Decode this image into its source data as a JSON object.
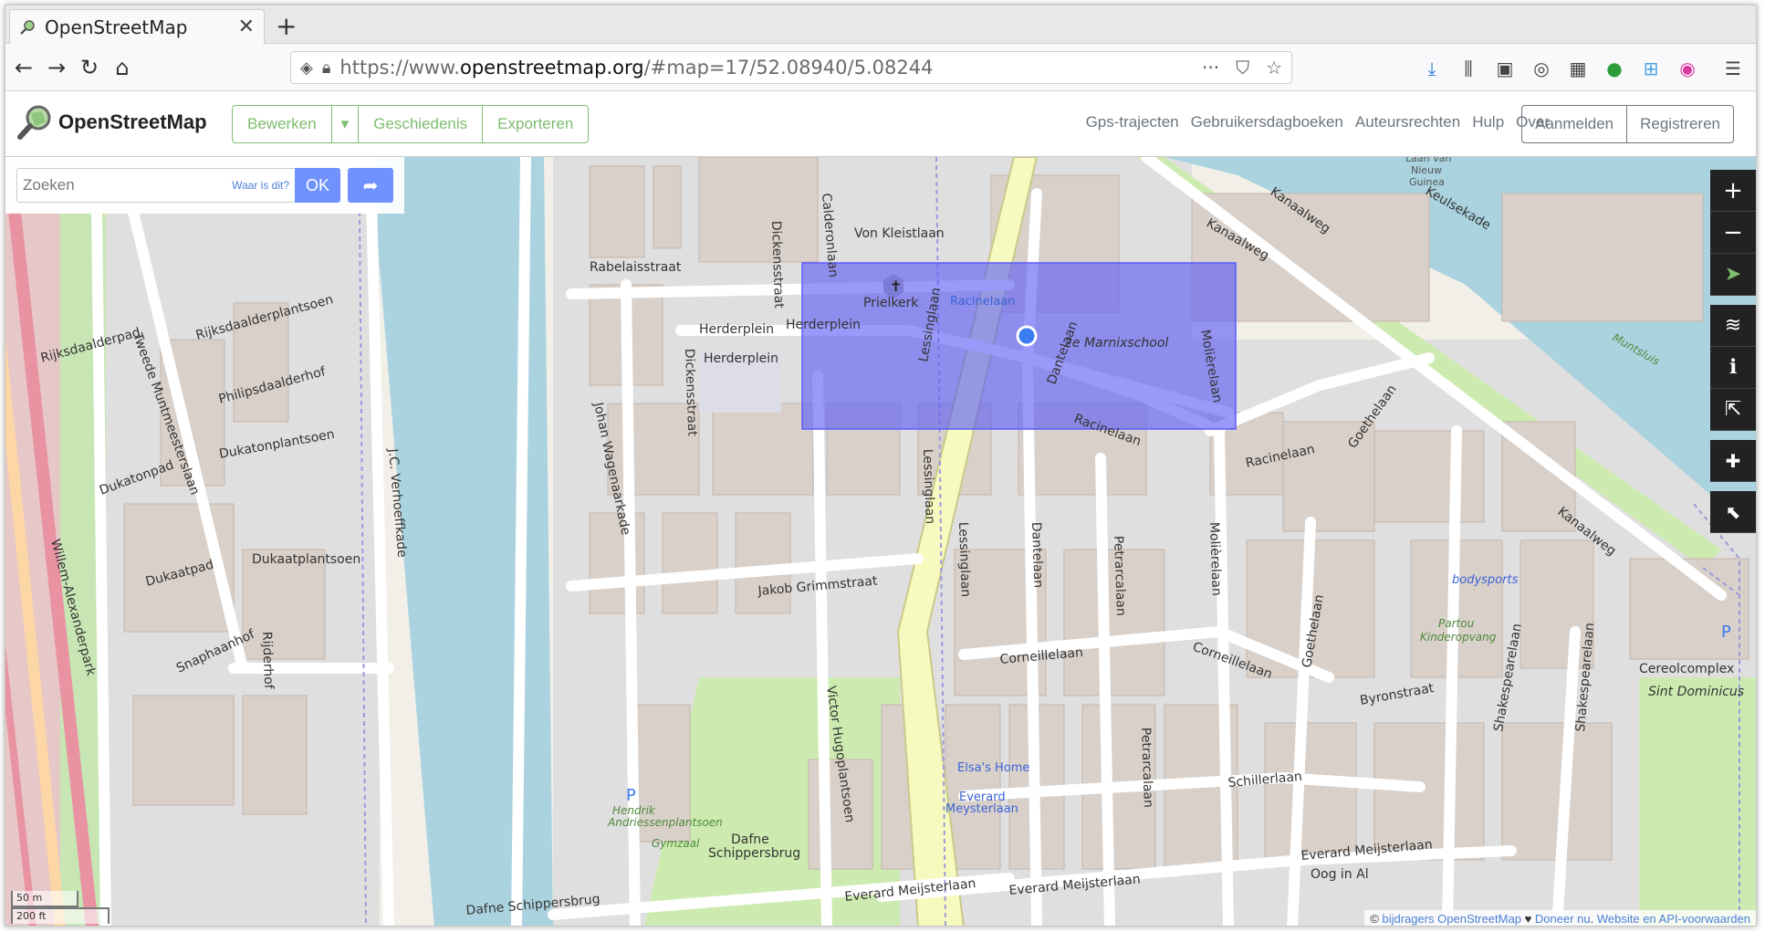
{
  "browser": {
    "tab_title": "OpenStreetMap",
    "url_prefix": "https://www.",
    "url_domain": "openstreetmap.org",
    "url_rest": "/#map=17/52.08940/5.08244"
  },
  "osm": {
    "logo_text": "OpenStreetMap",
    "edit_label": "Bewerken",
    "history_label": "Geschiedenis",
    "export_label": "Exporteren",
    "nav": [
      "Gps-trajecten",
      "Gebruikersdagboeken",
      "Auteursrechten",
      "Hulp",
      "Over"
    ],
    "login_label": "Aanmelden",
    "register_label": "Registreren"
  },
  "search": {
    "placeholder": "Zoeken",
    "where_label": "Waar is dit?",
    "ok_label": "OK"
  },
  "map": {
    "streets": {
      "s1": "Johan Wagenaarkade",
      "s2": "Rabelaisstraat",
      "s3": "Von Kleistlaan",
      "s4": "Herderplein",
      "s5": "Dickensstraat",
      "s6": "Lessinglaan",
      "s7": "Dantelaan",
      "s8": "Racinelaan",
      "s9": "Molièrelaan",
      "s10": "Kanaalweg",
      "s11": "Keulsekade",
      "s12": "Goethelaan",
      "s13": "Jakob Grimmstraat",
      "s14": "Corneillelaan",
      "s15": "Petrarcalaan",
      "s16": "Byronstraat",
      "s17": "Schillerlaan",
      "s18": "Everard Meijsterlaan",
      "s19": "Shakespearelaan",
      "s20": "Victor Hugoplantsoen",
      "s21": "Tweede Muntmeesterslaan",
      "s22": "Rijksdaalderplantsoen",
      "s23": "Philipsdaalderhof",
      "s24": "Dukatonplantsoen",
      "s25": "Dukatonpad",
      "s26": "Dukaatplantsoen",
      "s27": "Dukaatpad",
      "s28": "Snaphaanhof",
      "s29": "Rijderhof",
      "s30": "J.C. Verhoeffkade",
      "s31": "Willem-Alexanderpark",
      "s32": "Dafne Schippersbrug",
      "s33": "Rijksdaalderpad",
      "s34": "Calderonlaan",
      "s35": "Muntsluis"
    },
    "pois": {
      "church": "Prielkerk",
      "school": "2e Marnixschool",
      "bus": "Racinelaan",
      "sports": "bodysports",
      "kinder1": "Partou",
      "kinder2": "Kinderopvang",
      "cinema": "Cereolcomplex",
      "stdom": "Sint Dominicus",
      "elsa": "Elsa's Home",
      "everard1": "Everard",
      "everard2": "Meysterlaan",
      "gym": "Gymzaal",
      "dafne1": "Dafne",
      "dafne2": "Schippersbrug",
      "park1": "Hendrik",
      "park2": "Andriessenplantsoen",
      "oog": "Oog in Al",
      "nieuw1": "Laan van",
      "nieuw2": "Nieuw",
      "nieuw3": "Guinea",
      "herderplein_sq": "Herderplein"
    },
    "scale_m": "50 m",
    "scale_ft": "200 ft",
    "attribution_prefix": "© ",
    "attribution_link": "bijdragers OpenStreetMap",
    "attribution_heart": " ♥ ",
    "attribution_donate": "Doneer nu",
    "attribution_sep": ". ",
    "attribution_web": "Website en API-voorwaarden"
  },
  "colors": {
    "brand_green": "#7ebc6f",
    "search_blue": "#7092ff",
    "selection": "#4b4bff"
  }
}
